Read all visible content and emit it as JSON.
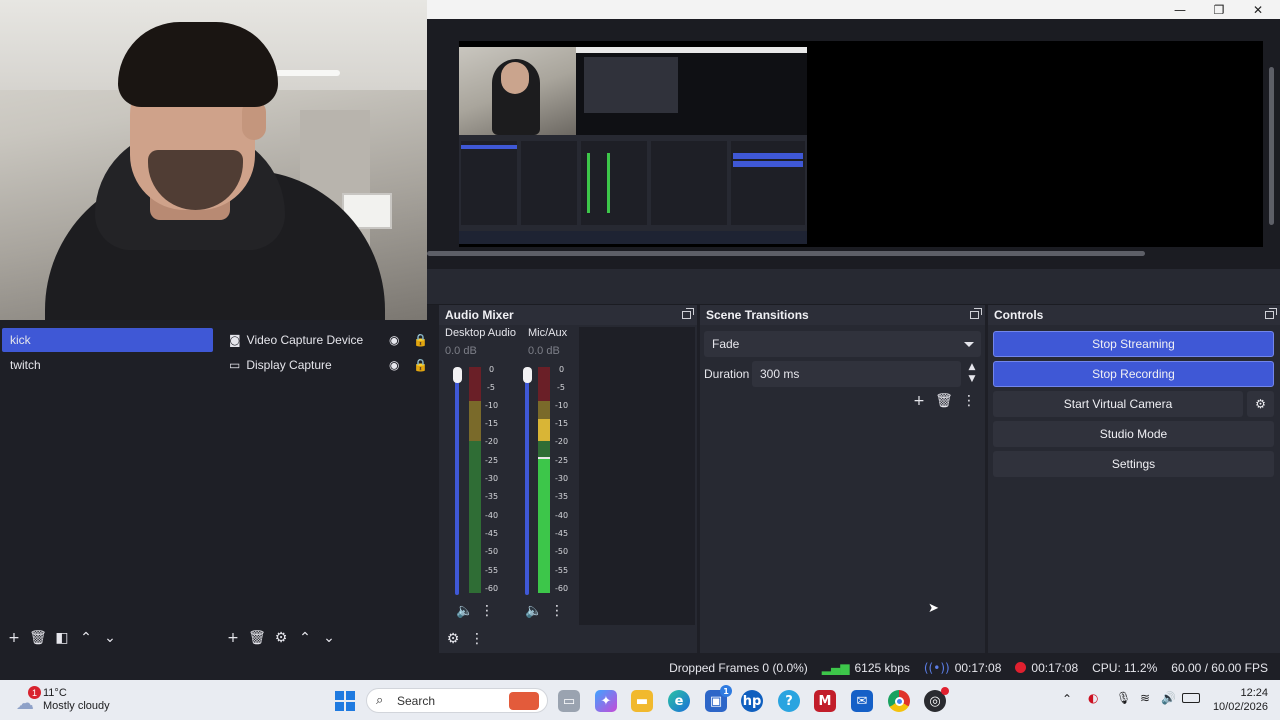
{
  "window": {
    "minimize": "—",
    "maximize": "❐",
    "close": "✕"
  },
  "scenes": {
    "items": [
      {
        "label": "kick",
        "selected": true
      },
      {
        "label": "twitch",
        "selected": false
      }
    ]
  },
  "sources": {
    "items": [
      {
        "label": "Video Capture Device",
        "icon": "camera-icon"
      },
      {
        "label": "Display Capture",
        "icon": "monitor-icon"
      }
    ]
  },
  "audio_mixer": {
    "title": "Audio Mixer",
    "channels": [
      {
        "name": "Desktop Audio",
        "db": "0.0 dB",
        "fader_level": 1.0,
        "meter_level": 0.0
      },
      {
        "name": "Mic/Aux",
        "db": "0.0 dB",
        "fader_level": 1.0,
        "meter_level": 0.77
      }
    ],
    "scale": [
      "0",
      "-5",
      "-10",
      "-15",
      "-20",
      "-25",
      "-30",
      "-35",
      "-40",
      "-45",
      "-50",
      "-55",
      "-60"
    ]
  },
  "scene_transitions": {
    "title": "Scene Transitions",
    "transition": "Fade",
    "duration_label": "Duration",
    "duration_value": "300 ms"
  },
  "controls": {
    "title": "Controls",
    "stop_streaming": "Stop Streaming",
    "stop_recording": "Stop Recording",
    "start_virtual_camera": "Start Virtual Camera",
    "studio_mode": "Studio Mode",
    "settings": "Settings"
  },
  "status": {
    "dropped_frames": "Dropped Frames 0 (0.0%)",
    "bitrate": "6125 kbps",
    "stream_time": "00:17:08",
    "record_time": "00:17:08",
    "cpu": "CPU: 11.2%",
    "fps": "60.00 / 60.00 FPS"
  },
  "taskbar": {
    "weather_badge": "1",
    "temperature": "11°C",
    "weather_text": "Mostly cloudy",
    "search_placeholder": "Search",
    "store_badge": "1",
    "time": "12:24",
    "date": "10/02/2026"
  },
  "colors": {
    "accent": "#3f58d6",
    "panel": "#272932",
    "list_bg": "#1e1f26",
    "meter_green": "#3dc64a",
    "meter_yellow": "#d9b536",
    "meter_red": "#c7202f"
  }
}
